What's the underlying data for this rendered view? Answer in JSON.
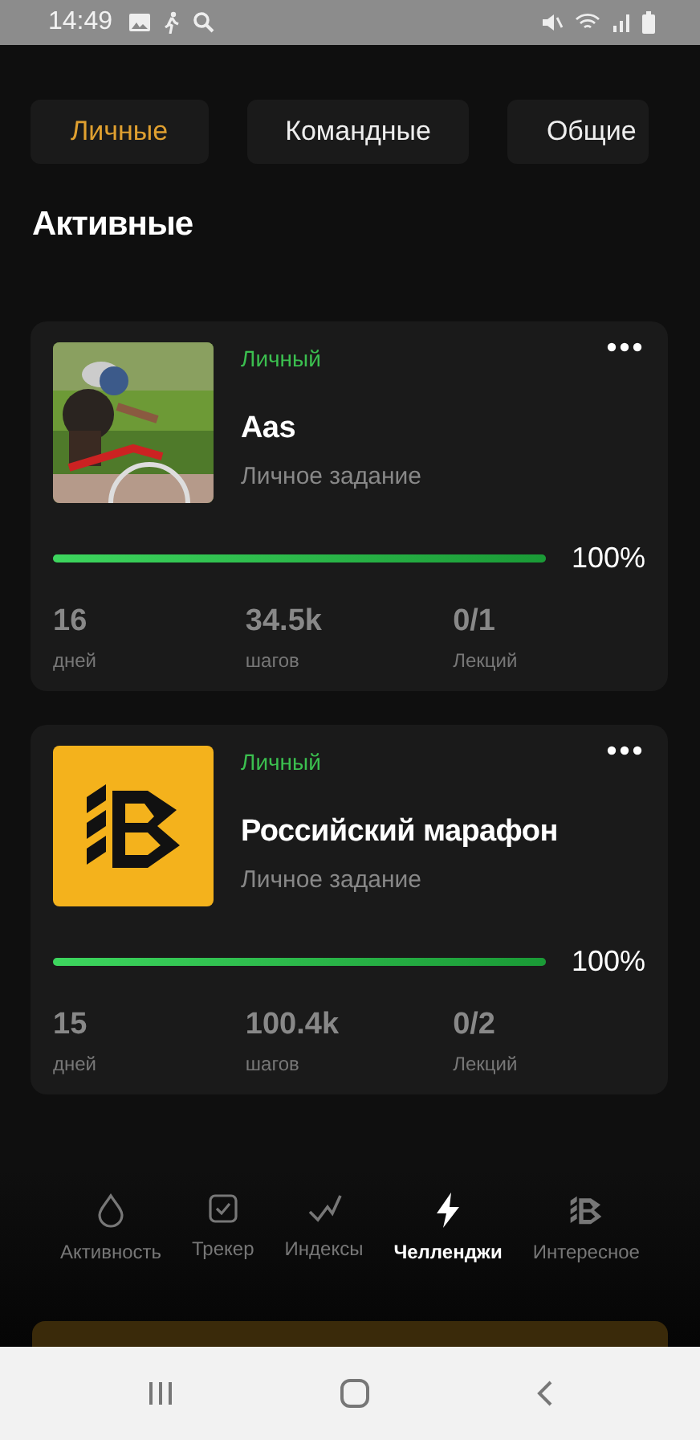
{
  "status_bar": {
    "time": "14:49"
  },
  "tabs": [
    {
      "label": "Личные",
      "selected": true
    },
    {
      "label": "Командные",
      "selected": false
    },
    {
      "label": "Общие",
      "selected": false
    }
  ],
  "section_title": "Активные",
  "challenges": [
    {
      "tag": "Личный",
      "title": "Aas",
      "subtitle": "Личное задание",
      "level": 1,
      "percent": "100%",
      "stats": [
        {
          "value": "16",
          "label": "дней"
        },
        {
          "value": "34.5k",
          "label": "шагов"
        },
        {
          "value": "0/1",
          "label": "Лекций"
        }
      ]
    },
    {
      "image": {
        "kind": "logo"
      },
      "tag": "Личный",
      "title": "Российский марафон",
      "subtitle": "Личное задание",
      "level": 1,
      "percent": "100%",
      "stats": [
        {
          "value": "15",
          "label": "дней"
        },
        {
          "value": "100.4k",
          "label": "шагов"
        },
        {
          "value": "0/2",
          "label": "Лекций"
        }
      ]
    }
  ],
  "bottom_nav": [
    {
      "kind": "drop",
      "label": "Активность",
      "selected": false
    },
    {
      "kind": "check",
      "label": "Трекер",
      "selected": false
    },
    {
      "kind": "wave",
      "label": "Индексы",
      "selected": false
    },
    {
      "kind": "bolt",
      "label": "Челленджи",
      "selected": true
    },
    {
      "kind": "logo",
      "label": "Интересное",
      "selected": false
    }
  ]
}
